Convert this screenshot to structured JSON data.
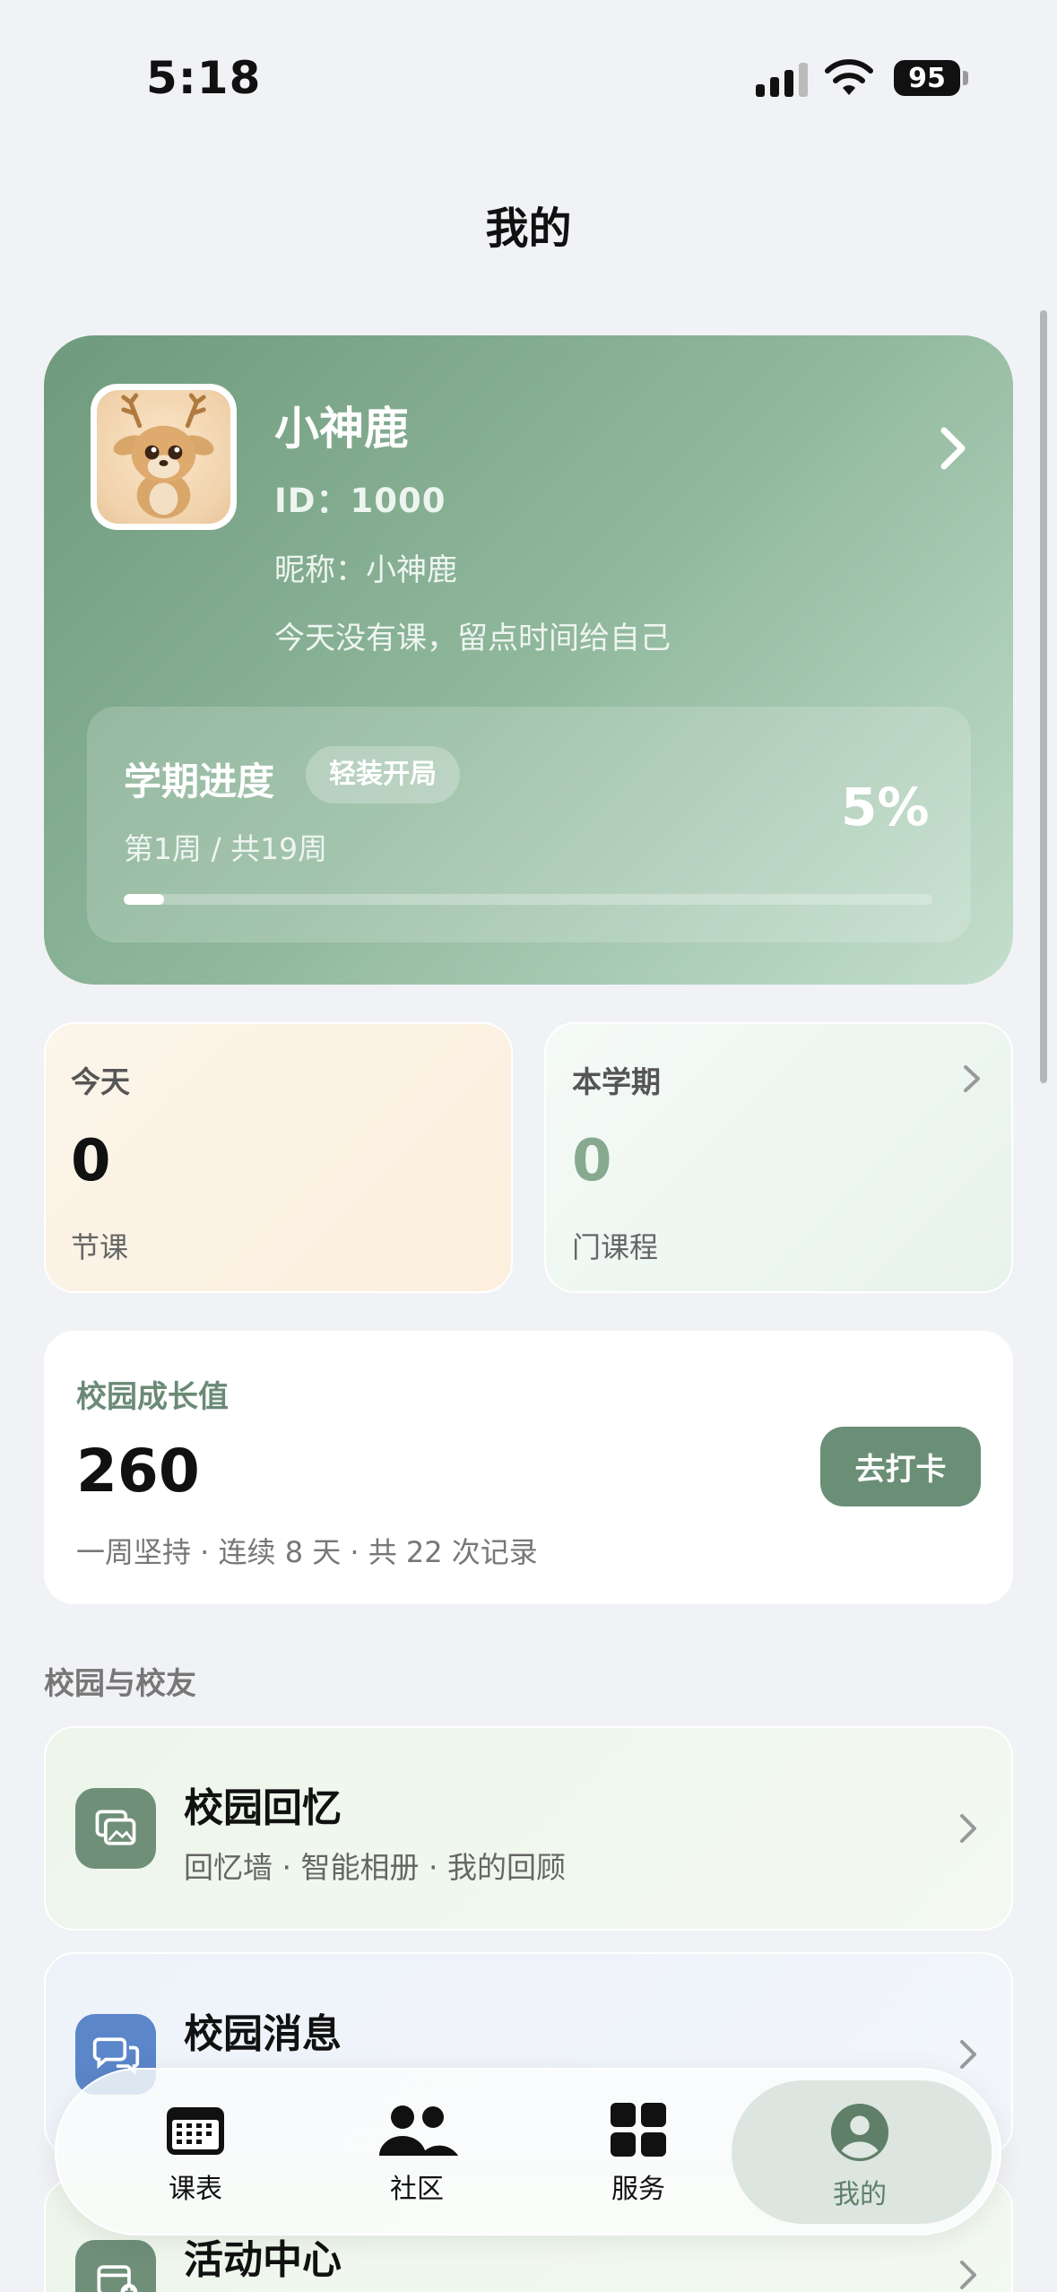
{
  "status_bar": {
    "time": "5:18",
    "battery": "95"
  },
  "page_title": "我的",
  "profile": {
    "name": "小神鹿",
    "id_text": "ID：1000",
    "nickname_text": "昵称：小神鹿",
    "tip": "今天没有课，留点时间给自己"
  },
  "term_progress": {
    "title": "学期进度",
    "badge": "轻装开局",
    "weeks_text": "第1周 / 共19周",
    "percent_text": "5%",
    "percent": 0.05
  },
  "stats": {
    "today": {
      "label": "今天",
      "value": "0",
      "unit": "节课"
    },
    "term": {
      "label": "本学期",
      "value": "0",
      "unit": "门课程"
    }
  },
  "growth": {
    "label": "校园成长值",
    "value": "260",
    "sub": "一周坚持 · 连续 8 天 · 共 22 次记录",
    "button": "去打卡"
  },
  "section_title": "校园与校友",
  "list": [
    {
      "title": "校园回忆",
      "sub": "回忆墙 · 智能相册 · 我的回顾"
    },
    {
      "title": "校园消息"
    },
    {
      "title": "活动中心"
    }
  ],
  "tabs": [
    {
      "label": "课表"
    },
    {
      "label": "社区"
    },
    {
      "label": "服务"
    },
    {
      "label": "我的"
    }
  ],
  "colors": {
    "accent": "#6b8f76",
    "active_tab": "#5f7f69"
  }
}
